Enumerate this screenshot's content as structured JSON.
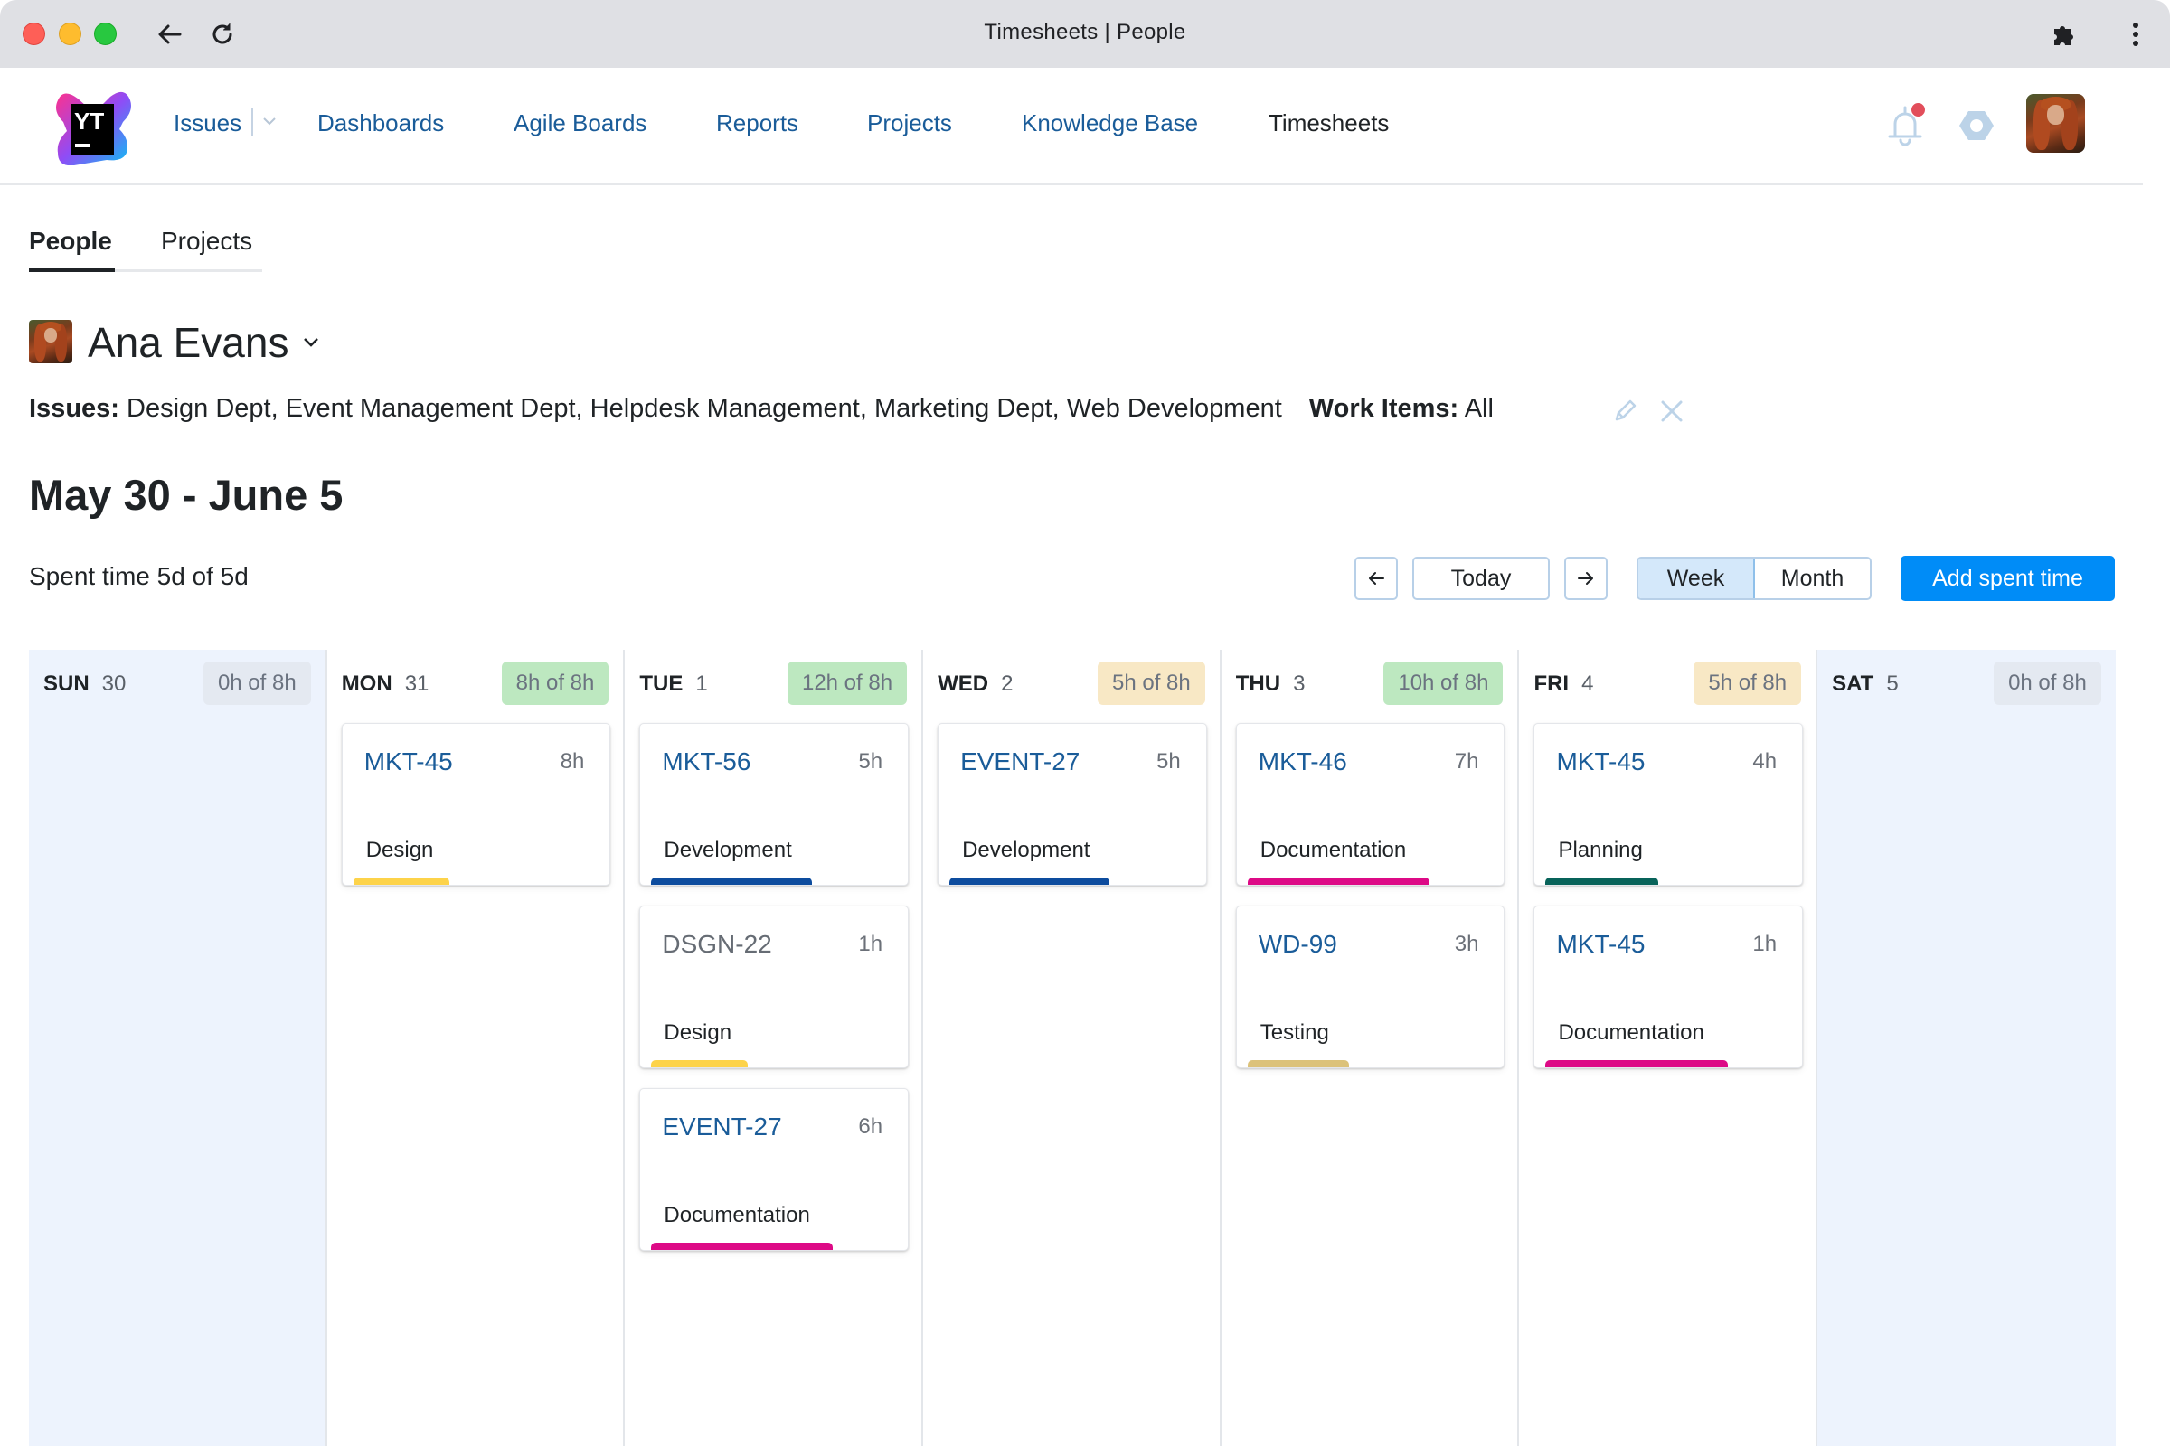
{
  "browser": {
    "title": "Timesheets | People"
  },
  "nav": {
    "items": [
      {
        "label": "Issues",
        "active": false
      },
      {
        "label": "Dashboards",
        "active": false
      },
      {
        "label": "Agile Boards",
        "active": false
      },
      {
        "label": "Reports",
        "active": false
      },
      {
        "label": "Projects",
        "active": false
      },
      {
        "label": "Knowledge Base",
        "active": false
      },
      {
        "label": "Timesheets",
        "active": true
      }
    ],
    "logo_text": "YT",
    "notification_badge": true
  },
  "tabs": [
    {
      "label": "People",
      "active": true
    },
    {
      "label": "Projects",
      "active": false
    }
  ],
  "person": {
    "name": "Ana Evans"
  },
  "filters": {
    "issues_label": "Issues:",
    "issues_value": "Design Dept, Event Management Dept, Helpdesk Management, Marketing Dept, Web Development",
    "work_items_label": "Work Items:",
    "work_items_value": "All"
  },
  "period": {
    "title": "May 30 - June 5",
    "spent_summary": "Spent time 5d of 5d"
  },
  "controls": {
    "prev_icon": "arrow-left-icon",
    "today_label": "Today",
    "next_icon": "arrow-right-icon",
    "view_options": [
      "Week",
      "Month"
    ],
    "active_view": "Week",
    "add_label": "Add spent time"
  },
  "colors": {
    "accent": "#008cf7",
    "link": "#1a5c99",
    "total_full": "#bde8c0",
    "total_partial": "#f8e8c5",
    "total_none": "#e4e9f1",
    "weekend": "#edf3fd",
    "type_design": "#fdd34a",
    "type_development": "#0d4c9e",
    "type_documentation": "#dd0a86",
    "type_planning": "#08635a",
    "type_testing": "#dcc27a"
  },
  "days": [
    {
      "name": "SUN",
      "num": "30",
      "total": "0h of 8h",
      "status": "none",
      "weekend": true,
      "entries": []
    },
    {
      "name": "MON",
      "num": "31",
      "total": "8h of 8h",
      "status": "full",
      "weekend": false,
      "entries": [
        {
          "id": "MKT-45",
          "hours": "8h",
          "type": "Design",
          "color": "#fdd34a",
          "muted": false,
          "stripe": 0.36
        }
      ]
    },
    {
      "name": "TUE",
      "num": "1",
      "total": "12h of 8h",
      "status": "full",
      "weekend": false,
      "entries": [
        {
          "id": "MKT-56",
          "hours": "5h",
          "type": "Development",
          "color": "#0d4c9e",
          "muted": false,
          "stripe": 0.6
        },
        {
          "id": "DSGN-22",
          "hours": "1h",
          "type": "Design",
          "color": "#fdd34a",
          "muted": true,
          "stripe": 0.36
        },
        {
          "id": "EVENT-27",
          "hours": "6h",
          "type": "Documentation",
          "color": "#dd0a86",
          "muted": false,
          "stripe": 0.68
        }
      ]
    },
    {
      "name": "WED",
      "num": "2",
      "total": "5h of 8h",
      "status": "partial",
      "weekend": false,
      "entries": [
        {
          "id": "EVENT-27",
          "hours": "5h",
          "type": "Development",
          "color": "#0d4c9e",
          "muted": false,
          "stripe": 0.6
        }
      ]
    },
    {
      "name": "THU",
      "num": "3",
      "total": "10h of 8h",
      "status": "full",
      "weekend": false,
      "entries": [
        {
          "id": "MKT-46",
          "hours": "7h",
          "type": "Documentation",
          "color": "#dd0a86",
          "muted": false,
          "stripe": 0.68
        },
        {
          "id": "WD-99",
          "hours": "3h",
          "type": "Testing",
          "color": "#dcc27a",
          "muted": false,
          "stripe": 0.38
        }
      ]
    },
    {
      "name": "FRI",
      "num": "4",
      "total": "5h of 8h",
      "status": "partial",
      "weekend": false,
      "entries": [
        {
          "id": "MKT-45",
          "hours": "4h",
          "type": "Planning",
          "color": "#08635a",
          "muted": false,
          "stripe": 0.42
        },
        {
          "id": "MKT-45",
          "hours": "1h",
          "type": "Documentation",
          "color": "#dd0a86",
          "muted": false,
          "stripe": 0.68
        }
      ]
    },
    {
      "name": "SAT",
      "num": "5",
      "total": "0h of 8h",
      "status": "none",
      "weekend": true,
      "entries": []
    }
  ]
}
